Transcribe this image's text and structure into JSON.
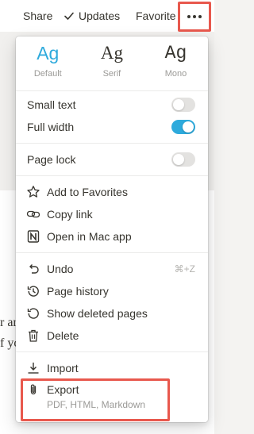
{
  "topbar": {
    "share_label": "Share",
    "updates_label": "Updates",
    "favorite_label": "Favorite"
  },
  "background": {
    "line1": "r ar",
    "line2": "f yo"
  },
  "font_options": [
    {
      "glyph": "Ag",
      "label": "Default",
      "selected": true
    },
    {
      "glyph": "Ag",
      "label": "Serif",
      "selected": false
    },
    {
      "glyph": "Ag",
      "label": "Mono",
      "selected": false
    }
  ],
  "toggles": {
    "small_text": {
      "label": "Small text",
      "on": false
    },
    "full_width": {
      "label": "Full width",
      "on": true
    },
    "page_lock": {
      "label": "Page lock",
      "on": false
    }
  },
  "actions": {
    "add_to_favorites": "Add to Favorites",
    "copy_link": "Copy link",
    "open_in_mac_app": "Open in Mac app",
    "undo": "Undo",
    "undo_shortcut": "⌘+Z",
    "page_history": "Page history",
    "show_deleted_pages": "Show deleted pages",
    "delete": "Delete",
    "import": "Import",
    "export": "Export",
    "export_formats": "PDF, HTML, Markdown"
  },
  "colors": {
    "accent": "#2eaadc",
    "highlight": "#e8584d"
  }
}
